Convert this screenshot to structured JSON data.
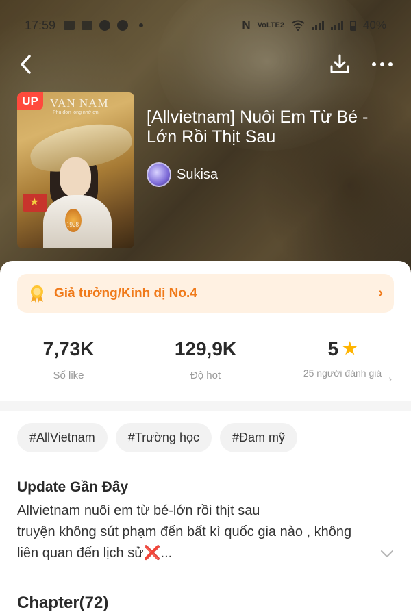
{
  "status_bar": {
    "time": "17:59",
    "network_label": "VoLTE2",
    "battery": "40%"
  },
  "book": {
    "title": "[Allvietnam] Nuôi Em Từ Bé - Lớn Rồi Thịt Sau",
    "author": "Sukisa",
    "badge": "UP",
    "cover_title": "VAN NAM",
    "cover_subtitle": "Phụ đơn lòng nhờ ơn",
    "cover_year": "1928"
  },
  "ranking": {
    "label": "Giả tưởng/Kinh dị No.4"
  },
  "stats": {
    "likes_value": "7,73K",
    "likes_label": "Số like",
    "hot_value": "129,9K",
    "hot_label": "Độ hot",
    "rating_value": "5",
    "rating_label": "25 người đánh giá"
  },
  "tags": [
    "#AllVietnam",
    "#Trường học",
    "#Đam mỹ"
  ],
  "update": {
    "title": "Update Gần Đây",
    "line1": "Allvietnam nuôi em từ bé-lớn rồi thịt sau",
    "line2": "truyện không sút phạm đến bất kì quốc gia nào , không",
    "line3": "liên quan đến lịch sử",
    "line3_mark": "❌",
    "line3_ellipsis": "..."
  },
  "chapters": {
    "title": "Chapter(72)"
  },
  "colors": {
    "accent": "#f07a1a",
    "rank_bg": "#fff1e2",
    "badge_red": "#ff4a3d",
    "star": "#ffb400"
  },
  "icons": [
    "back-icon",
    "download-icon",
    "more-icon",
    "medal-icon",
    "chevron-right-icon",
    "star-icon",
    "chevron-down-icon"
  ]
}
